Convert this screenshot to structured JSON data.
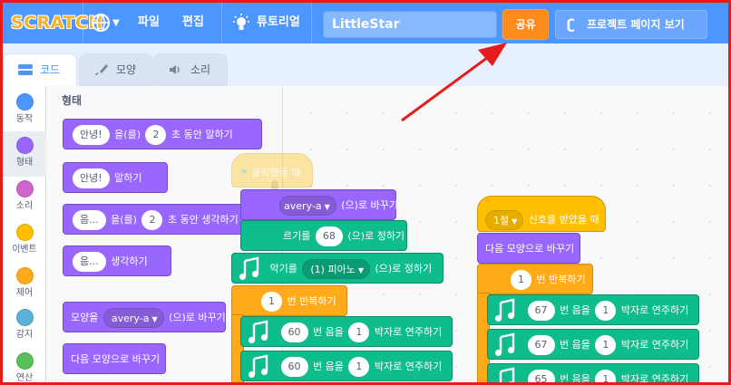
{
  "menubar": {
    "logo_text": "SCRATCH",
    "file_label": "파일",
    "edit_label": "편집",
    "tutorials_label": "튜토리얼",
    "project_title": "LittleStar",
    "share_label": "공유",
    "see_project_label": "프로젝트 페이지 보기",
    "accent_color": "#4c97ff",
    "share_color": "#ff8c1a"
  },
  "tabs": [
    {
      "label": "코드",
      "icon": "code-icon",
      "active": true
    },
    {
      "label": "모양",
      "icon": "brush-icon",
      "active": false
    },
    {
      "label": "소리",
      "icon": "speaker-icon",
      "active": false
    }
  ],
  "categories": [
    {
      "label": "동작",
      "color": "#4c97ff"
    },
    {
      "label": "형태",
      "color": "#9966ff",
      "selected": true
    },
    {
      "label": "소리",
      "color": "#cf63cf"
    },
    {
      "label": "이벤트",
      "color": "#ffbf00"
    },
    {
      "label": "제어",
      "color": "#ffab19"
    },
    {
      "label": "감지",
      "color": "#5cb1d6"
    },
    {
      "label": "연산",
      "color": "#59c059"
    }
  ],
  "flyout": {
    "title": "형태",
    "say_for": {
      "text": "안녕!",
      "mid": "을(를)",
      "secs": "2",
      "tail": "초 동안 말하기"
    },
    "say": {
      "text": "안녕!",
      "tail": "말하기"
    },
    "think_for": {
      "text": "음...",
      "mid": "을(를)",
      "secs": "2",
      "tail": "초 동안 생각하기"
    },
    "think": {
      "text": "음...",
      "tail": "생각하기"
    },
    "switch_costume": {
      "head": "모양을",
      "value": "avery-a",
      "tail": "(으)로 바꾸기"
    },
    "next_costume": "다음 모양으로 바꾸기"
  },
  "workspace": {
    "script1": {
      "hat": "클릭했을 때",
      "switch_costume": {
        "value": "avery-a",
        "tail": "(으)로 바꾸기"
      },
      "set_tempo": {
        "head": "르기를",
        "value": "68",
        "tail": "(으)로 정하기"
      },
      "set_instrument": {
        "head": "악기를",
        "value": "(1) 피아노",
        "tail": "(으)로 정하기"
      },
      "repeat": {
        "value": "1",
        "tail": "번 반복하기"
      },
      "notes": [
        {
          "note": "60",
          "mid": "번 음을",
          "beats": "1",
          "tail": "박자로 연주하기"
        },
        {
          "note": "60",
          "mid": "번 음을",
          "beats": "1",
          "tail": "박자로 연주하기"
        }
      ]
    },
    "script2": {
      "hat": {
        "value": "1절",
        "tail": "신호를 받았을 때"
      },
      "next_costume": "다음 모양으로 바꾸기",
      "repeat": {
        "value": "1",
        "tail": "번 반복하기"
      },
      "notes": [
        {
          "note": "67",
          "mid": "번 음을",
          "beats": "1",
          "tail": "박자로 연주하기"
        },
        {
          "note": "67",
          "mid": "번 음을",
          "beats": "1",
          "tail": "박자로 연주하기"
        },
        {
          "note": "65",
          "mid": "번 음을",
          "beats": "1",
          "tail": "박자로 연주하기"
        }
      ]
    }
  }
}
